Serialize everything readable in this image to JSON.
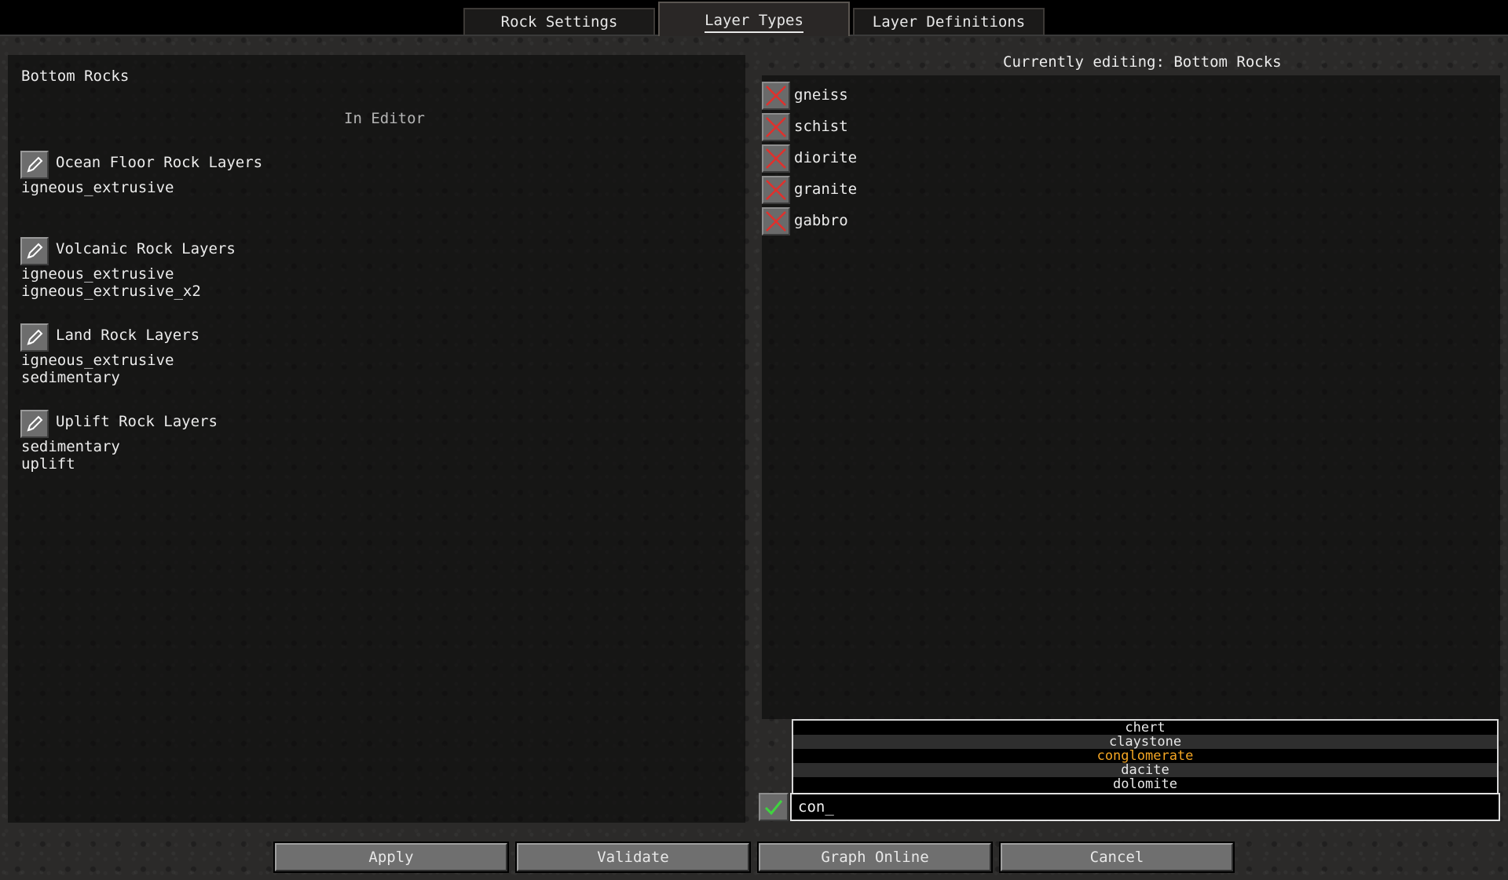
{
  "tabs": [
    "Rock Settings",
    "Layer Types",
    "Layer Definitions"
  ],
  "left": {
    "title": "Bottom Rocks",
    "subtitle": "In Editor",
    "groups": [
      {
        "name": "Ocean Floor Rock Layers",
        "items": [
          "igneous_extrusive"
        ]
      },
      {
        "name": "Volcanic Rock Layers",
        "items": [
          "igneous_extrusive",
          "igneous_extrusive_x2"
        ]
      },
      {
        "name": "Land Rock Layers",
        "items": [
          "igneous_extrusive",
          "sedimentary"
        ]
      },
      {
        "name": "Uplift Rock Layers",
        "items": [
          "sedimentary",
          "uplift"
        ]
      }
    ]
  },
  "right": {
    "header": "Currently editing: Bottom Rocks",
    "rocks": [
      "gneiss",
      "schist",
      "diorite",
      "granite",
      "gabbro"
    ],
    "suggestions": [
      "chert",
      "claystone",
      "conglomerate",
      "dacite",
      "dolomite"
    ],
    "selected_suggestion": "conglomerate",
    "input_value": "con_"
  },
  "buttons": [
    "Apply",
    "Validate",
    "Graph Online",
    "Cancel"
  ],
  "colors": {
    "remove_x": "#e0302c",
    "confirm_check": "#3fd43f",
    "highlight": "#f5a623"
  }
}
